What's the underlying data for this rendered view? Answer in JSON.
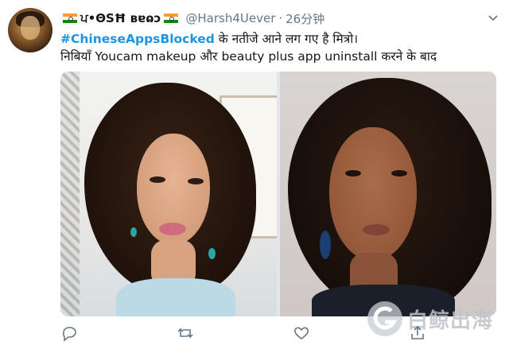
{
  "author": {
    "display_name": "ਪ•ΘSĦ ʙɐɷɔ",
    "handle": "@Harsh4Uever",
    "separator": "·",
    "time": "26分钟"
  },
  "tweet": {
    "hashtag": "#ChineseAppsBlocked",
    "line1_rest": " के नतीजे आने लग गए है मित्रो।",
    "line2": "निबियाँ Youcam makeup और beauty plus app uninstall करने के बाद"
  },
  "watermark": {
    "text": "白鲸出海"
  },
  "colors": {
    "link": "#1b95e0",
    "secondary": "#657786",
    "icon": "#657786"
  }
}
